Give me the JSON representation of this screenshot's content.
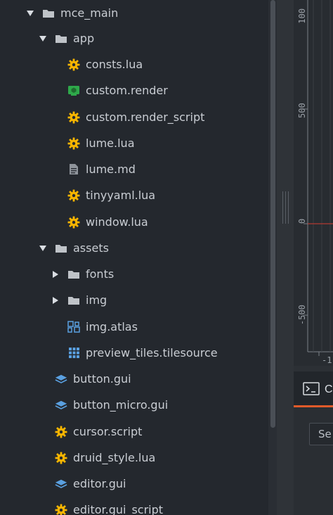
{
  "tree": {
    "items": [
      {
        "label": "mce_main",
        "arrow": "down",
        "icon": "folder-icon"
      },
      {
        "label": "app",
        "arrow": "down",
        "icon": "folder-icon"
      },
      {
        "label": "consts.lua",
        "arrow": "none",
        "icon": "script-gear-icon"
      },
      {
        "label": "custom.render",
        "arrow": "none",
        "icon": "render-icon"
      },
      {
        "label": "custom.render_script",
        "arrow": "none",
        "icon": "script-gear-icon"
      },
      {
        "label": "lume.lua",
        "arrow": "none",
        "icon": "script-gear-icon"
      },
      {
        "label": "lume.md",
        "arrow": "none",
        "icon": "document-icon"
      },
      {
        "label": "tinyyaml.lua",
        "arrow": "none",
        "icon": "script-gear-icon"
      },
      {
        "label": "window.lua",
        "arrow": "none",
        "icon": "script-gear-icon"
      },
      {
        "label": "assets",
        "arrow": "down",
        "icon": "folder-icon"
      },
      {
        "label": "fonts",
        "arrow": "right",
        "icon": "folder-icon"
      },
      {
        "label": "img",
        "arrow": "right",
        "icon": "folder-icon"
      },
      {
        "label": "img.atlas",
        "arrow": "none",
        "icon": "atlas-icon"
      },
      {
        "label": "preview_tiles.tilesource",
        "arrow": "none",
        "icon": "tilesource-icon"
      },
      {
        "label": "button.gui",
        "arrow": "none",
        "icon": "gui-layers-icon"
      },
      {
        "label": "button_micro.gui",
        "arrow": "none",
        "icon": "gui-layers-icon"
      },
      {
        "label": "cursor.script",
        "arrow": "none",
        "icon": "script-gear-icon"
      },
      {
        "label": "druid_style.lua",
        "arrow": "none",
        "icon": "script-gear-icon"
      },
      {
        "label": "editor.gui",
        "arrow": "none",
        "icon": "gui-layers-icon"
      },
      {
        "label": "editor.gui_script",
        "arrow": "none",
        "icon": "script-gear-icon"
      }
    ]
  },
  "plot": {
    "tick_labels": [
      "100",
      "500",
      "0",
      "-500"
    ],
    "x_tick_label": "-1"
  },
  "console": {
    "tab_label": "C",
    "search_placeholder": "Se"
  },
  "colors": {
    "gear": "#f5b400",
    "folder": "#bfc3c8",
    "gui": "#5aa0e0",
    "render": "#2ea84a",
    "accent": "#e05a2a",
    "zero_line": "#b23a32"
  }
}
